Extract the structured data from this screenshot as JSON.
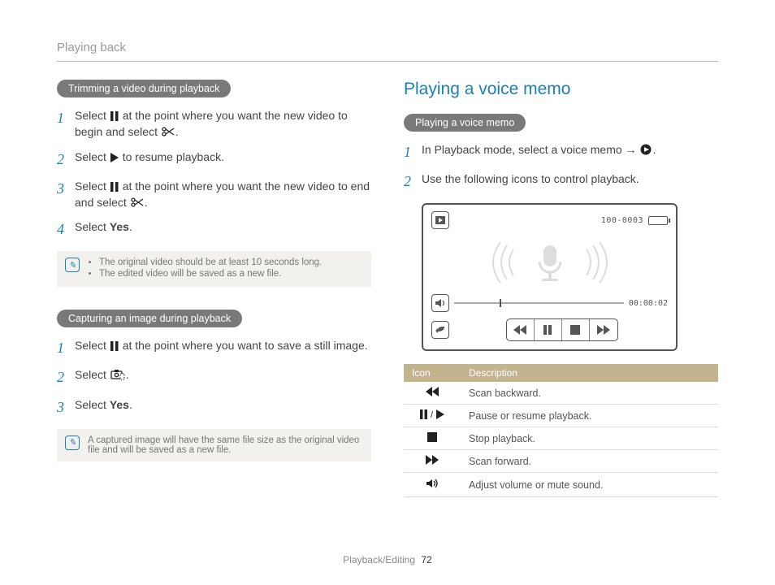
{
  "header": {
    "title": "Playing back"
  },
  "footer": {
    "section": "Playback/Editing",
    "page": "72"
  },
  "left": {
    "trim": {
      "pill": "Trimming a video during playback",
      "steps": [
        {
          "n": "1",
          "pre": "Select ",
          "icon": "pause",
          "mid": " at the point where you want the new video to begin and select ",
          "icon2": "scissors",
          "post": "."
        },
        {
          "n": "2",
          "pre": "Select ",
          "icon": "play-solid",
          "post": " to resume playback."
        },
        {
          "n": "3",
          "pre": "Select ",
          "icon": "pause",
          "mid": " at the point where you want the new video to end and select ",
          "icon2": "scissors",
          "post": "."
        },
        {
          "n": "4",
          "pre": "Select ",
          "bold": "Yes",
          "post": "."
        }
      ],
      "notes": [
        "The original video should be at least 10 seconds long.",
        "The edited video will be saved as a new file."
      ]
    },
    "capture": {
      "pill": "Capturing an image during playback",
      "steps": [
        {
          "n": "1",
          "pre": "Select ",
          "icon": "pause",
          "post": " at the point where you want to save a still image."
        },
        {
          "n": "2",
          "pre": "Select ",
          "icon": "camera-crop",
          "post": "."
        },
        {
          "n": "3",
          "pre": "Select ",
          "bold": "Yes",
          "post": "."
        }
      ],
      "note": "A captured image will have the same file size as the original video file and will be saved as a new file."
    }
  },
  "right": {
    "title": "Playing a voice memo",
    "pill": "Playing a voice memo",
    "steps": [
      {
        "n": "1",
        "pre": "In Playback mode, select a voice memo → ",
        "icon": "play-circle",
        "post": "."
      },
      {
        "n": "2",
        "pre": "Use the following icons to control playback."
      }
    ],
    "screen": {
      "file_label": "100-0003",
      "time": "00:00:02"
    },
    "table": {
      "headers": [
        "Icon",
        "Description"
      ],
      "rows": [
        {
          "icon": "rewind",
          "desc": "Scan backward."
        },
        {
          "icon": "pause-play",
          "desc": "Pause or resume playback."
        },
        {
          "icon": "stop",
          "desc": "Stop playback."
        },
        {
          "icon": "forward",
          "desc": "Scan forward."
        },
        {
          "icon": "volume",
          "desc": "Adjust volume or mute sound."
        }
      ]
    }
  }
}
